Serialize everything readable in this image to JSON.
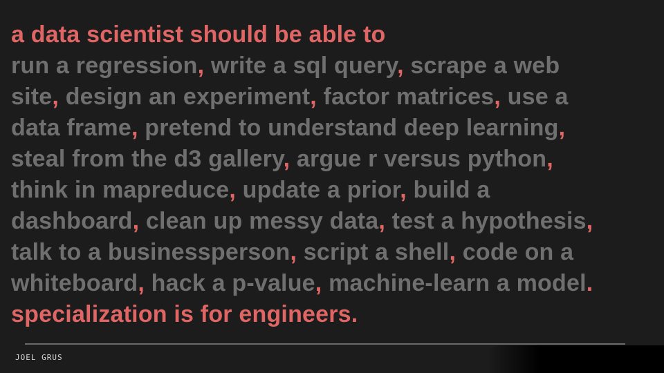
{
  "slide": {
    "heading": "a data scientist should be able to",
    "lines": [
      {
        "segments": [
          {
            "text": "run a regression",
            "accent": false
          },
          {
            "text": ",",
            "accent": true
          },
          {
            "text": " write a sql query",
            "accent": false
          },
          {
            "text": ",",
            "accent": true
          },
          {
            "text": " scrape a web",
            "accent": false
          }
        ]
      },
      {
        "segments": [
          {
            "text": "site",
            "accent": false
          },
          {
            "text": ",",
            "accent": true
          },
          {
            "text": " design an experiment",
            "accent": false
          },
          {
            "text": ",",
            "accent": true
          },
          {
            "text": " factor matrices",
            "accent": false
          },
          {
            "text": ",",
            "accent": true
          },
          {
            "text": " use a",
            "accent": false
          }
        ]
      },
      {
        "segments": [
          {
            "text": "data frame",
            "accent": false
          },
          {
            "text": ",",
            "accent": true
          },
          {
            "text": " pretend to understand deep learning",
            "accent": false
          },
          {
            "text": ",",
            "accent": true
          }
        ]
      },
      {
        "segments": [
          {
            "text": "steal from the d3 gallery",
            "accent": false
          },
          {
            "text": ",",
            "accent": true
          },
          {
            "text": " argue r versus python",
            "accent": false
          },
          {
            "text": ",",
            "accent": true
          }
        ]
      },
      {
        "segments": [
          {
            "text": "think in mapreduce",
            "accent": false
          },
          {
            "text": ",",
            "accent": true
          },
          {
            "text": " update a prior",
            "accent": false
          },
          {
            "text": ",",
            "accent": true
          },
          {
            "text": " build a",
            "accent": false
          }
        ]
      },
      {
        "segments": [
          {
            "text": "dashboard",
            "accent": false
          },
          {
            "text": ",",
            "accent": true
          },
          {
            "text": " clean up messy data",
            "accent": false
          },
          {
            "text": ",",
            "accent": true
          },
          {
            "text": " test a hypothesis",
            "accent": false
          },
          {
            "text": ",",
            "accent": true
          }
        ]
      },
      {
        "segments": [
          {
            "text": "talk to a businessperson",
            "accent": false
          },
          {
            "text": ",",
            "accent": true
          },
          {
            "text": " script a shell",
            "accent": false
          },
          {
            "text": ",",
            "accent": true
          },
          {
            "text": " code on a",
            "accent": false
          }
        ]
      },
      {
        "segments": [
          {
            "text": "whiteboard",
            "accent": false
          },
          {
            "text": ",",
            "accent": true
          },
          {
            "text": " hack a p-value",
            "accent": false
          },
          {
            "text": ",",
            "accent": true
          },
          {
            "text": " machine-learn a model",
            "accent": false
          },
          {
            "text": ".",
            "accent": true
          }
        ]
      }
    ],
    "closing": "specialization is for engineers.",
    "author": "JOEL GRUS"
  },
  "colors": {
    "background": "#1c1c1c",
    "accent": "#e06666",
    "body_text": "#6f6f6f",
    "author_text": "#d8d8d8",
    "rule": "#6a6a6a"
  }
}
